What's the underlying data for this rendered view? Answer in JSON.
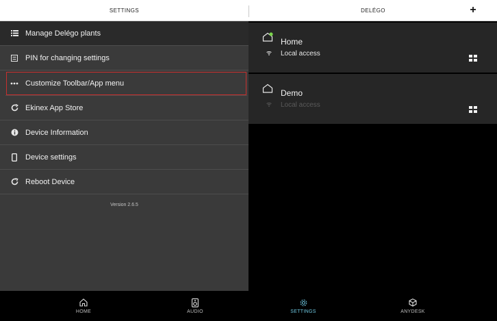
{
  "header": {
    "left_title": "SETTINGS",
    "right_title": "DELÉGO",
    "add_label": "+"
  },
  "settings_menu": {
    "items": [
      {
        "label": "Manage Delégo plants",
        "icon": "list-icon"
      },
      {
        "label": "PIN for changing settings",
        "icon": "pin-icon"
      },
      {
        "label": "Customize Toolbar/App menu",
        "icon": "more-icon"
      },
      {
        "label": "Ekinex App Store",
        "icon": "store-icon"
      },
      {
        "label": "Device Information",
        "icon": "info-icon"
      },
      {
        "label": "Device settings",
        "icon": "device-icon"
      },
      {
        "label": "Reboot Device",
        "icon": "reboot-icon"
      }
    ],
    "selected_index": 2,
    "version": "Version 2.6.5"
  },
  "plants": [
    {
      "name": "Home",
      "access": "Local access",
      "active": true
    },
    {
      "name": "Demo",
      "access": "Local access",
      "active": false
    }
  ],
  "tabs": [
    {
      "label": "HOME",
      "icon": "home-icon",
      "active": false
    },
    {
      "label": "AUDIO",
      "icon": "speaker-icon",
      "active": false
    },
    {
      "label": "SETTINGS",
      "icon": "gear-icon",
      "active": true
    },
    {
      "label": "ANYDESK",
      "icon": "anydesk-icon",
      "active": false
    }
  ],
  "colors": {
    "accent": "#6ec7e0",
    "selection_border": "#c8302e",
    "online_dot": "#7bd34c"
  }
}
